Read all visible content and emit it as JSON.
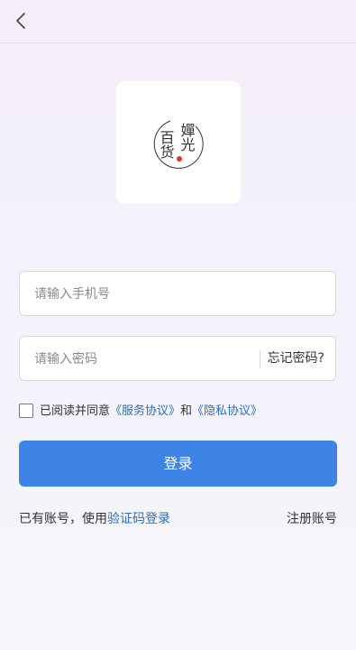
{
  "header": {
    "back_icon": "chevron-left-icon"
  },
  "logo": {
    "text_top": "嬋光",
    "text_bottom": "百货",
    "accent_color": "#d9352b"
  },
  "form": {
    "phone_placeholder": "请输入手机号",
    "password_placeholder": "请输入密码",
    "forgot_label": "忘记密码?"
  },
  "agreement": {
    "prefix": "已阅读并同意",
    "service_link": "《服务协议》",
    "conjunction": "和",
    "privacy_link": "《隐私协议》",
    "checked": false
  },
  "login_button": "登录",
  "footer": {
    "has_account": "已有账号，使用",
    "sms_login_link": "验证码登录",
    "register_label": "注册账号"
  },
  "colors": {
    "primary": "#3d84e6",
    "link": "#2d6fb8"
  }
}
